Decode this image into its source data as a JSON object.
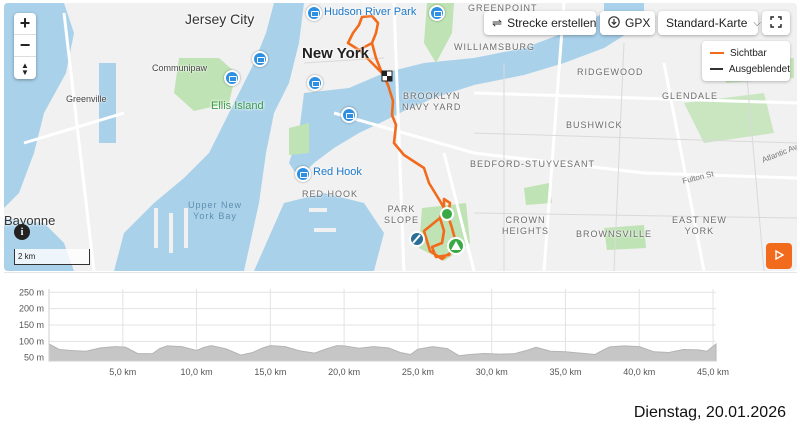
{
  "map": {
    "labels": {
      "jersey_city": "Jersey City",
      "new_york": "New York",
      "bayonne": "Bayonne",
      "hudson_river_park": "Hudson River Park",
      "ellis_island": "Ellis Island",
      "red_hook_poi": "Red Hook",
      "red_hook": "RED HOOK",
      "communipaw": "Communipaw",
      "greenville": "Greenville",
      "upper_ny_bay_1": "Upper New",
      "upper_ny_bay_2": "York Bay",
      "greenpoint": "GREENPOINT",
      "williamsburg": "WILLIAMSBURG",
      "ridgewood": "RIDGEWOOD",
      "glendale": "GLENDALE",
      "bushwick": "BUSHWICK",
      "bk_navy_yard_1": "BROOKLYN",
      "bk_navy_yard_2": "NAVY YARD",
      "bed_stuy": "BEDFORD-STUYVESANT",
      "park_slope_1": "PARK",
      "park_slope_2": "SLOPE",
      "crown_heights_1": "CROWN",
      "crown_heights_2": "HEIGHTS",
      "brownsville": "BROWNSVILLE",
      "east_ny_1": "EAST NEW",
      "east_ny_2": "YORK",
      "fulton_st": "Fulton St",
      "atlantic_av": "Atlantic Av"
    },
    "zoom_in": "+",
    "zoom_out": "−",
    "compass": "▲▼",
    "scale_label": "2 km",
    "info": "i"
  },
  "toolbar": {
    "strecke_label": "Strecke erstellen",
    "gpx_label": "GPX",
    "karte_label": "Standard-Karte",
    "route_icon": "route-icon",
    "download_icon": "download-icon",
    "fullscreen_icon": "fullscreen-icon"
  },
  "legend": {
    "sichtbar": "Sichtbar",
    "ausgeblendet": "Ausgeblendet",
    "sichtbar_color": "#f26b1d",
    "ausgeblendet_color": "#333333"
  },
  "colors": {
    "route": "#f26b1d",
    "water": "#a9d1ea",
    "park": "#bfe3b4",
    "accent": "#f26b1d"
  },
  "chart_data": {
    "type": "area",
    "title": "",
    "xlabel": "",
    "ylabel": "",
    "xlim": [
      0,
      45.2
    ],
    "ylim": [
      40,
      260
    ],
    "y_ticks": [
      "250 m",
      "200 m",
      "150 m",
      "100 m",
      "50 m"
    ],
    "y_tick_values": [
      250,
      200,
      150,
      100,
      50
    ],
    "x_ticks": [
      "5,0 km",
      "10,0 km",
      "15,0 km",
      "20,0 km",
      "25,0 km",
      "30,0 km",
      "35,0 km",
      "40,0 km",
      "45,0 km"
    ],
    "x_tick_values": [
      5,
      10,
      15,
      20,
      25,
      30,
      35,
      40,
      45
    ],
    "grid": true,
    "series": [
      {
        "x": [
          0,
          0.7,
          1.5,
          2.5,
          3.5,
          4.5,
          5.2,
          6,
          7,
          7.5,
          8,
          9,
          10,
          10.5,
          11,
          12,
          13,
          13.8,
          14.5,
          15,
          16,
          17,
          18,
          18.8,
          19.5,
          20,
          21,
          22,
          23,
          23.8,
          24.5,
          25,
          26,
          27,
          27.8,
          28.5,
          29.5,
          30.5,
          31.5,
          32.5,
          33,
          34,
          35,
          36,
          37,
          37.5,
          38,
          39,
          40,
          41,
          42,
          43,
          44,
          44.6,
          45.2
        ],
        "y": [
          92,
          75,
          72,
          70,
          80,
          84,
          82,
          63,
          62,
          78,
          86,
          84,
          72,
          82,
          87,
          77,
          58,
          66,
          80,
          87,
          84,
          71,
          64,
          77,
          87,
          86,
          79,
          84,
          80,
          66,
          60,
          76,
          84,
          78,
          56,
          60,
          63,
          61,
          62,
          74,
          82,
          70,
          68,
          64,
          60,
          72,
          83,
          86,
          84,
          68,
          66,
          75,
          74,
          70,
          92
        ]
      }
    ]
  },
  "date_text": "Dienstag, 20.01.2026"
}
